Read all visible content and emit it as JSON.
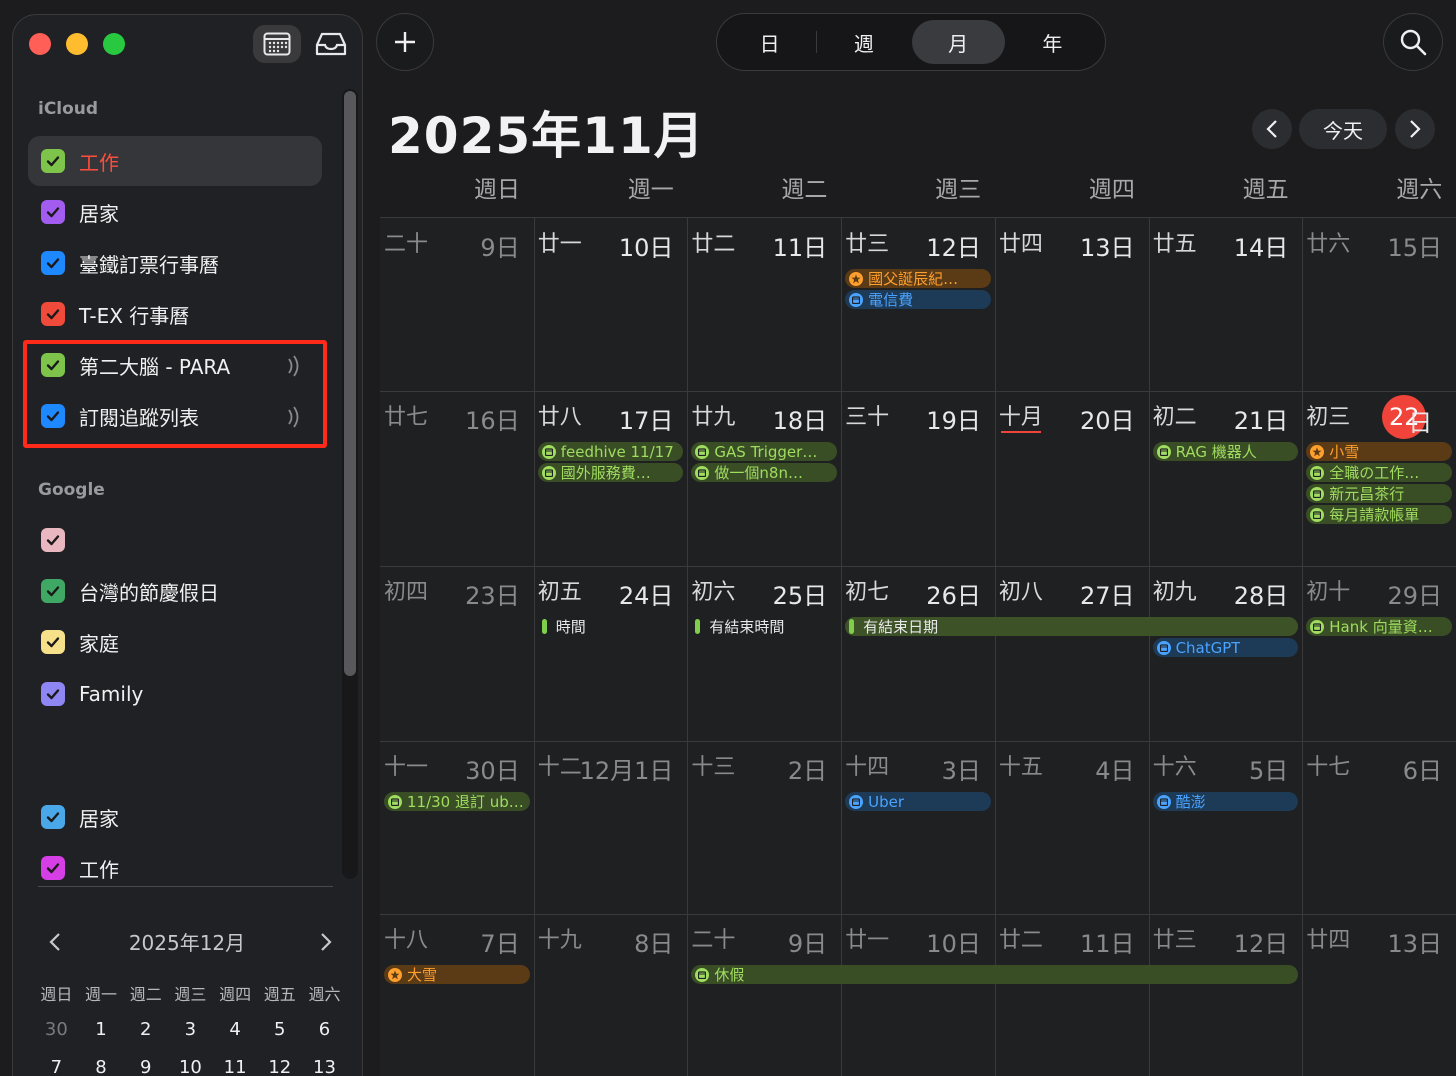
{
  "sidebar": {
    "groups": {
      "icloud": "iCloud",
      "google": "Google"
    },
    "calendars": [
      {
        "label": "工作",
        "color": "#7ec44a",
        "label_color": "#ff4d3d"
      },
      {
        "label": "居家",
        "color": "#a35cf0",
        "label_color": "#f0f0f2"
      },
      {
        "label": "臺鐵訂票行事曆",
        "color": "#1e88ff",
        "label_color": "#f0f0f2"
      },
      {
        "label": "T-EX 行事曆",
        "color": "#f04a3a",
        "label_color": "#f0f0f2"
      },
      {
        "label": "第二大腦 - PARA",
        "color": "#7ec44a",
        "label_color": "#f0f0f2"
      },
      {
        "label": "訂閱追蹤列表",
        "color": "#1e88ff",
        "label_color": "#f0f0f2"
      },
      {
        "label": "",
        "color": "#e9b7bf",
        "label_color": "#f0f0f2"
      },
      {
        "label": "台灣的節慶假日",
        "color": "#3fa864",
        "label_color": "#f0f0f2"
      },
      {
        "label": "家庭",
        "color": "#f6e08a",
        "label_color": "#f0f0f2"
      },
      {
        "label": "Family",
        "color": "#8e86f2",
        "label_color": "#f0f0f2"
      },
      {
        "label": "居家",
        "color": "#4aa8e8",
        "label_color": "#f0f0f2"
      },
      {
        "label": "工作",
        "color": "#d63ee6",
        "label_color": "#f0f0f2"
      }
    ],
    "mini": {
      "title": "2025年12月",
      "weekdays": [
        "週日",
        "週一",
        "週二",
        "週三",
        "週四",
        "週五",
        "週六"
      ],
      "row1": [
        "30",
        "1",
        "2",
        "3",
        "4",
        "5",
        "6"
      ],
      "row2": [
        "7",
        "8",
        "9",
        "10",
        "11",
        "12",
        "13"
      ]
    }
  },
  "toolbar": {
    "views": [
      "日",
      "週",
      "月",
      "年"
    ],
    "active_view": "月",
    "today_label": "今天"
  },
  "month_title": "2025年11月",
  "weekdays": [
    "週日",
    "週一",
    "週二",
    "週三",
    "週四",
    "週五",
    "週六"
  ],
  "weeks": [
    {
      "cells": [
        {
          "lunar": "二十",
          "date": "9日",
          "dim": true
        },
        {
          "lunar": "廿一",
          "date": "10日"
        },
        {
          "lunar": "廿二",
          "date": "11日"
        },
        {
          "lunar": "廿三",
          "date": "12日"
        },
        {
          "lunar": "廿四",
          "date": "13日"
        },
        {
          "lunar": "廿五",
          "date": "14日"
        },
        {
          "lunar": "廿六",
          "date": "15日",
          "dim": true
        }
      ]
    },
    {
      "cells": [
        {
          "lunar": "廿七",
          "date": "16日",
          "dim": true
        },
        {
          "lunar": "廿八",
          "date": "17日"
        },
        {
          "lunar": "廿九",
          "date": "18日"
        },
        {
          "lunar": "三十",
          "date": "19日"
        },
        {
          "lunar": "十月",
          "date": "20日",
          "underline": true
        },
        {
          "lunar": "初二",
          "date": "21日"
        },
        {
          "lunar": "初三",
          "date": "22",
          "date_suffix": "日",
          "today": true
        }
      ]
    },
    {
      "cells": [
        {
          "lunar": "初四",
          "date": "23日",
          "dim": true
        },
        {
          "lunar": "初五",
          "date": "24日"
        },
        {
          "lunar": "初六",
          "date": "25日"
        },
        {
          "lunar": "初七",
          "date": "26日"
        },
        {
          "lunar": "初八",
          "date": "27日"
        },
        {
          "lunar": "初九",
          "date": "28日"
        },
        {
          "lunar": "初十",
          "date": "29日",
          "dim": true
        }
      ]
    },
    {
      "cells": [
        {
          "lunar": "十一",
          "date": "30日",
          "dim": true
        },
        {
          "lunar": "十二",
          "date": "12月1日",
          "dim": true
        },
        {
          "lunar": "十三",
          "date": "2日",
          "dim": true
        },
        {
          "lunar": "十四",
          "date": "3日",
          "dim": true
        },
        {
          "lunar": "十五",
          "date": "4日",
          "dim": true
        },
        {
          "lunar": "十六",
          "date": "5日",
          "dim": true
        },
        {
          "lunar": "十七",
          "date": "6日",
          "dim": true
        }
      ]
    },
    {
      "cells": [
        {
          "lunar": "十八",
          "date": "7日",
          "dim": true
        },
        {
          "lunar": "十九",
          "date": "8日",
          "dim": true
        },
        {
          "lunar": "二十",
          "date": "9日",
          "dim": true
        },
        {
          "lunar": "廿一",
          "date": "10日",
          "dim": true
        },
        {
          "lunar": "廿二",
          "date": "11日",
          "dim": true
        },
        {
          "lunar": "廿三",
          "date": "12日",
          "dim": true
        },
        {
          "lunar": "廿四",
          "date": "13日",
          "dim": true
        }
      ]
    }
  ],
  "events": [
    {
      "week": 0,
      "col": 3,
      "span": 1,
      "slot": 0,
      "style": "orange",
      "icon": "star",
      "title": "國父誕辰紀…"
    },
    {
      "week": 0,
      "col": 3,
      "span": 1,
      "slot": 1,
      "style": "blue",
      "icon": "calendar",
      "title": "電信費"
    },
    {
      "week": 1,
      "col": 1,
      "span": 1,
      "slot": 0,
      "style": "green",
      "icon": "calendar",
      "title": "feedhive 11/17"
    },
    {
      "week": 1,
      "col": 1,
      "span": 1,
      "slot": 1,
      "style": "green",
      "icon": "calendar",
      "title": "國外服務費…"
    },
    {
      "week": 1,
      "col": 2,
      "span": 1,
      "slot": 0,
      "style": "green",
      "icon": "calendar",
      "title": "GAS Trigger…"
    },
    {
      "week": 1,
      "col": 2,
      "span": 1,
      "slot": 1,
      "style": "green",
      "icon": "calendar",
      "title": "做一個n8n…"
    },
    {
      "week": 1,
      "col": 5,
      "span": 1,
      "slot": 0,
      "style": "green",
      "icon": "calendar",
      "title": "RAG 機器人"
    },
    {
      "week": 1,
      "col": 6,
      "span": 1,
      "slot": 0,
      "style": "orange",
      "icon": "star",
      "title": "小雪"
    },
    {
      "week": 1,
      "col": 6,
      "span": 1,
      "slot": 1,
      "style": "green",
      "icon": "calendar",
      "title": "全職の工作…"
    },
    {
      "week": 1,
      "col": 6,
      "span": 1,
      "slot": 2,
      "style": "green",
      "icon": "calendar",
      "title": "新元昌茶行"
    },
    {
      "week": 1,
      "col": 6,
      "span": 1,
      "slot": 3,
      "style": "green",
      "icon": "calendar",
      "title": "每月請款帳單"
    },
    {
      "week": 2,
      "col": 1,
      "span": 1,
      "slot": 0,
      "style": "plain",
      "icon": "bar",
      "title": "時間"
    },
    {
      "week": 2,
      "col": 2,
      "span": 1,
      "slot": 0,
      "style": "plain",
      "icon": "bar",
      "title": "有結束時間"
    },
    {
      "week": 2,
      "col": 3,
      "span": 3,
      "slot": 0,
      "style": "bar",
      "icon": "bar",
      "title": "有結束日期"
    },
    {
      "week": 2,
      "col": 6,
      "span": 1,
      "slot": 0,
      "style": "green",
      "icon": "calendar",
      "title": "Hank 向量資…"
    },
    {
      "week": 2,
      "col": 5,
      "span": 1,
      "slot": 1,
      "style": "blue",
      "icon": "calendar",
      "title": "ChatGPT"
    },
    {
      "week": 3,
      "col": 0,
      "span": 1,
      "slot": 0,
      "style": "green",
      "icon": "calendar",
      "title": "11/30 退訂 ub…"
    },
    {
      "week": 3,
      "col": 3,
      "span": 1,
      "slot": 0,
      "style": "blue",
      "icon": "calendar",
      "title": "Uber"
    },
    {
      "week": 3,
      "col": 5,
      "span": 1,
      "slot": 0,
      "style": "blue",
      "icon": "calendar",
      "title": "酷澎"
    },
    {
      "week": 4,
      "col": 0,
      "span": 1,
      "slot": 0,
      "style": "orange",
      "icon": "star",
      "title": "大雪"
    },
    {
      "week": 4,
      "col": 2,
      "span": 4,
      "slot": 0,
      "style": "green",
      "icon": "calendar",
      "title": "休假"
    }
  ]
}
